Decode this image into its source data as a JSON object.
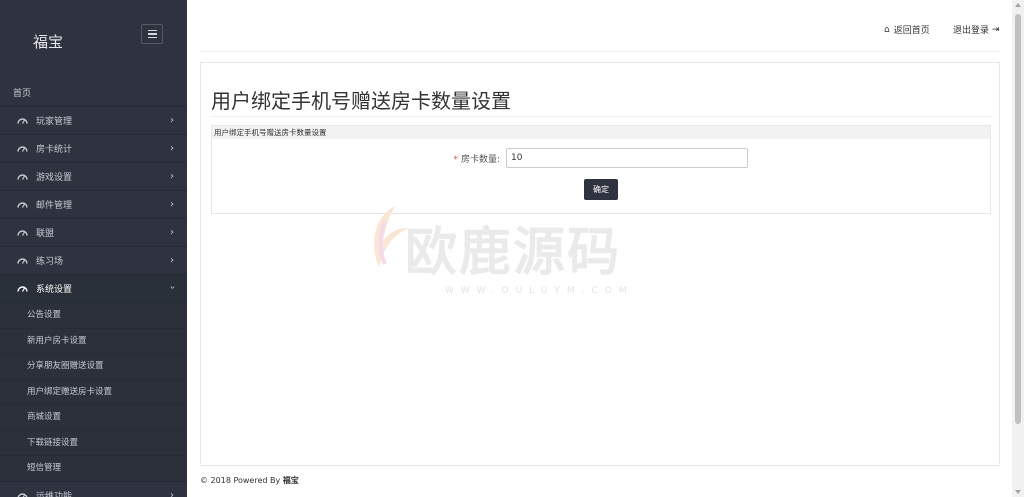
{
  "sidebar": {
    "brand": "福宝",
    "home": "首页",
    "items": [
      {
        "label": "玩家管理"
      },
      {
        "label": "房卡统计"
      },
      {
        "label": "游戏设置"
      },
      {
        "label": "邮件管理"
      },
      {
        "label": "联盟"
      },
      {
        "label": "练习场"
      },
      {
        "label": "系统设置"
      },
      {
        "label": "运维功能"
      }
    ],
    "subitems": [
      {
        "label": "公告设置"
      },
      {
        "label": "新用户房卡设置"
      },
      {
        "label": "分享朋友圈赠送设置"
      },
      {
        "label": "用户绑定赠送房卡设置"
      },
      {
        "label": "商城设置"
      },
      {
        "label": "下载链接设置"
      },
      {
        "label": "短信管理"
      }
    ]
  },
  "topbar": {
    "home_link": "返回首页",
    "logout_link": "退出登录"
  },
  "main": {
    "title": "用户绑定手机号赠送房卡数量设置",
    "panel_heading": "用户绑定手机号赠送房卡数量设置",
    "field_label": "房卡数量:",
    "field_required": "*",
    "field_value": "10",
    "submit_label": "确定"
  },
  "watermark": {
    "text": "欧鹿源码",
    "sub": "WWW.OULUYM.COM"
  },
  "footer": {
    "prefix": "© 2018 Powered By ",
    "brand": "福宝"
  }
}
